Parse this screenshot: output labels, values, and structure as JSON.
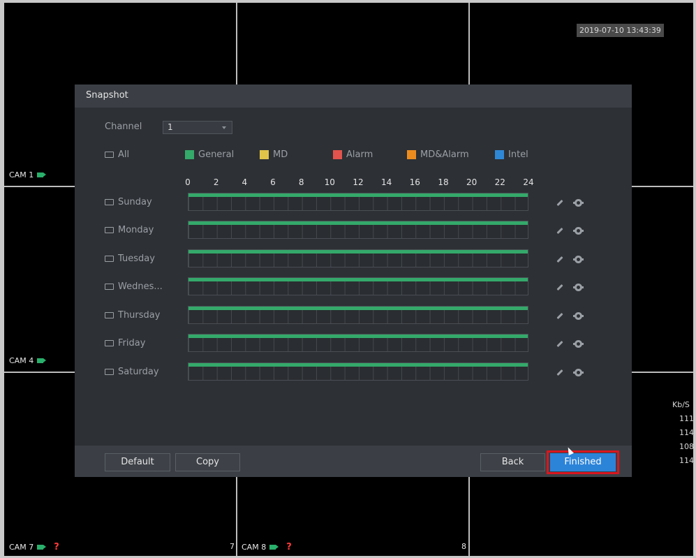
{
  "timestamp": "2019-07-10 13:43:39",
  "cameras": {
    "cam1": "CAM 1",
    "cam4": "CAM 4",
    "cam7": "CAM 7",
    "cam8": "CAM 8",
    "cam8_no": "7",
    "cam9_no": "8"
  },
  "status": {
    "unknown": "?"
  },
  "bitrate": {
    "unit": "Kb/S",
    "values": [
      "111",
      "114",
      "108",
      "114"
    ]
  },
  "dialog": {
    "title": "Snapshot",
    "channel_label": "Channel",
    "channel_value": "1",
    "all_label": "All",
    "legend": [
      {
        "label": "General",
        "color": "#34a96a"
      },
      {
        "label": "MD",
        "color": "#e0c44a"
      },
      {
        "label": "Alarm",
        "color": "#e2534d"
      },
      {
        "label": "MD&Alarm",
        "color": "#ec8c1f"
      },
      {
        "label": "Intel",
        "color": "#2f88d6"
      }
    ],
    "hour_ticks": [
      "0",
      "2",
      "4",
      "6",
      "8",
      "10",
      "12",
      "14",
      "16",
      "18",
      "20",
      "22",
      "24"
    ],
    "days": [
      {
        "label": "Sunday",
        "schedule": "General",
        "from_hour": 0,
        "to_hour": 24
      },
      {
        "label": "Monday",
        "schedule": "General",
        "from_hour": 0,
        "to_hour": 24
      },
      {
        "label": "Tuesday",
        "schedule": "General",
        "from_hour": 0,
        "to_hour": 24
      },
      {
        "label": "Wednes...",
        "schedule": "General",
        "from_hour": 0,
        "to_hour": 24
      },
      {
        "label": "Thursday",
        "schedule": "General",
        "from_hour": 0,
        "to_hour": 24
      },
      {
        "label": "Friday",
        "schedule": "General",
        "from_hour": 0,
        "to_hour": 24
      },
      {
        "label": "Saturday",
        "schedule": "General",
        "from_hour": 0,
        "to_hour": 24
      }
    ],
    "buttons": {
      "default": "Default",
      "copy": "Copy",
      "back": "Back",
      "finished": "Finished"
    }
  }
}
